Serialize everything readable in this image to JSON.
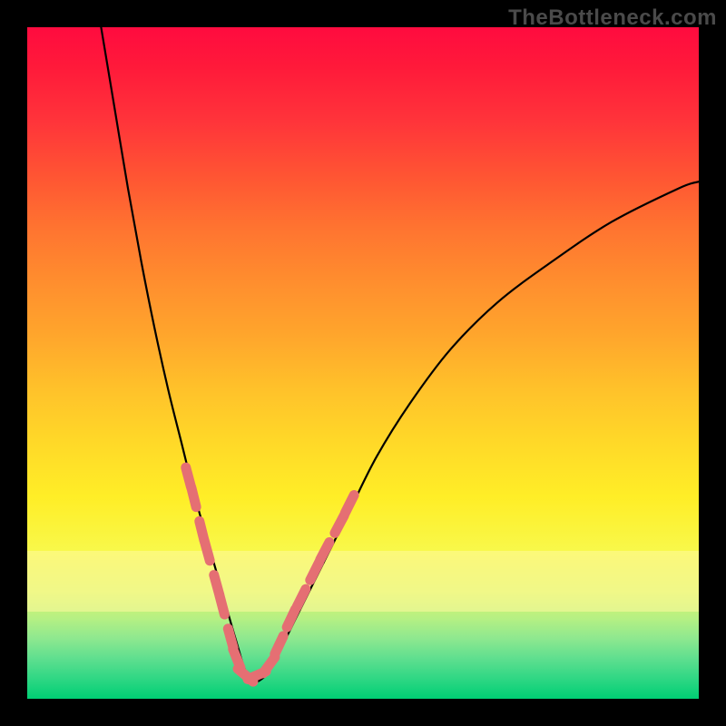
{
  "watermark": "TheBottleneck.com",
  "colors": {
    "bg": "#000000",
    "watermark": "#4a4a4a",
    "curve": "#000000",
    "marker": "#e56f73",
    "gradient_top": "#ff0b3f",
    "gradient_bottom": "#00cf74"
  },
  "chart_data": {
    "type": "line",
    "title": "",
    "xlabel": "",
    "ylabel": "",
    "xlim": [
      0,
      100
    ],
    "ylim": [
      0,
      100
    ],
    "grid": false,
    "legend": false,
    "annotations": [
      "TheBottleneck.com"
    ],
    "note": "Axes unlabeled; values estimated from pixel positions on a 0–100 scale. y=0 is bottom (green), y=100 is top (red). Curve is a V-shaped bottleneck profile with minimum near x≈33.",
    "series": [
      {
        "name": "bottleneck-curve",
        "x": [
          11,
          13,
          15,
          17,
          19,
          21,
          23,
          25,
          27,
          29,
          31,
          33,
          35,
          37,
          40,
          44,
          48,
          52,
          57,
          63,
          70,
          78,
          87,
          97,
          100
        ],
        "y": [
          100,
          88,
          76,
          65,
          55,
          46,
          38,
          30,
          23,
          16,
          9,
          3,
          3,
          6,
          12,
          20,
          28,
          36,
          44,
          52,
          59,
          65,
          71,
          76,
          77
        ]
      }
    ],
    "markers": {
      "name": "highlighted-segments",
      "note": "Pink capsule markers along the curve near the trough region (roughly y between 4 and 32).",
      "points": [
        {
          "x": 24.0,
          "y": 33
        },
        {
          "x": 24.8,
          "y": 30
        },
        {
          "x": 26.0,
          "y": 25
        },
        {
          "x": 26.8,
          "y": 22
        },
        {
          "x": 28.2,
          "y": 17
        },
        {
          "x": 29.0,
          "y": 14
        },
        {
          "x": 30.3,
          "y": 9
        },
        {
          "x": 31.2,
          "y": 6
        },
        {
          "x": 32.5,
          "y": 3.5
        },
        {
          "x": 34.2,
          "y": 3.5
        },
        {
          "x": 36.0,
          "y": 5
        },
        {
          "x": 37.5,
          "y": 8
        },
        {
          "x": 39.3,
          "y": 12
        },
        {
          "x": 40.8,
          "y": 15
        },
        {
          "x": 42.8,
          "y": 19
        },
        {
          "x": 44.3,
          "y": 22
        },
        {
          "x": 46.5,
          "y": 26
        },
        {
          "x": 48.0,
          "y": 29
        }
      ]
    }
  }
}
